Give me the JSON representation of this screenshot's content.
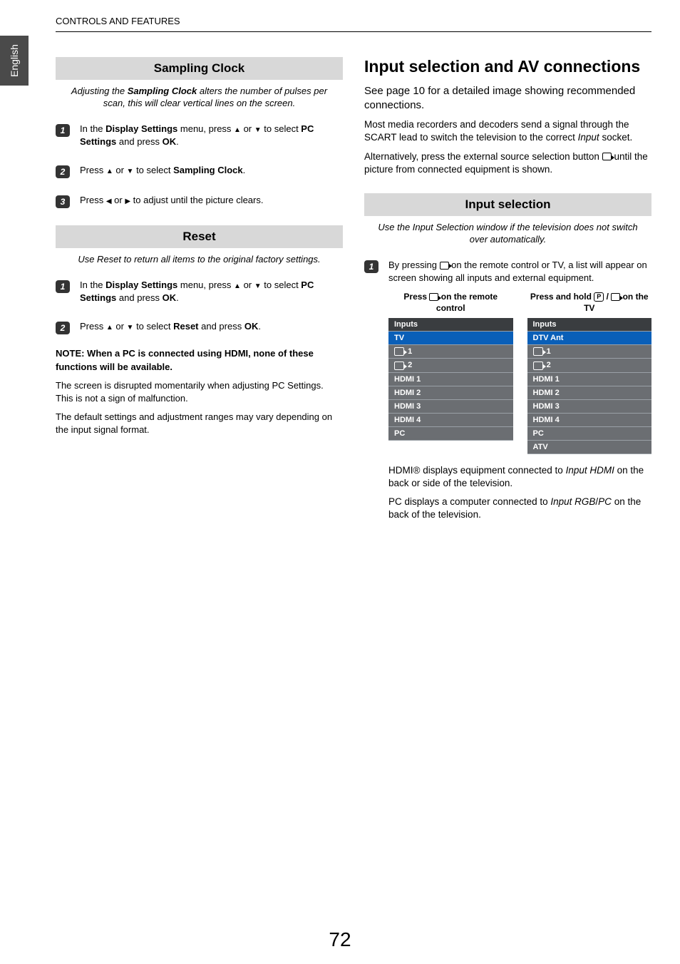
{
  "sideTab": "English",
  "headerText": "CONTROLS AND FEATURES",
  "pageNumber": "72",
  "left": {
    "samplingClock": {
      "title": "Sampling Clock",
      "intro_pre": "Adjusting the ",
      "intro_bold": "Sampling Clock",
      "intro_post": " alters the number of pulses per scan, this will clear vertical lines on the screen.",
      "steps": {
        "s1_a": "In the ",
        "s1_b": "Display Settings",
        "s1_c": " menu, press ",
        "s1_or": " or ",
        "s1_d": " to select ",
        "s1_e": "PC Settings",
        "s1_f": " and press ",
        "s1_g": "OK",
        "s1_h": ".",
        "s2_a": "Press ",
        "s2_b": " to select ",
        "s2_c": "Sampling Clock",
        "s2_d": ".",
        "s3_a": "Press ",
        "s3_b": " or ",
        "s3_c": " to adjust until the picture clears."
      }
    },
    "reset": {
      "title": "Reset",
      "intro": "Use Reset to return all items to the original factory settings.",
      "steps": {
        "s1_a": "In the ",
        "s1_b": "Display Settings",
        "s1_c": " menu, press ",
        "s1_or": " or ",
        "s1_d": " to select ",
        "s1_e": "PC Settings",
        "s1_f": " and press ",
        "s1_g": "OK",
        "s1_h": ".",
        "s2_a": "Press ",
        "s2_b": " to select ",
        "s2_c": "Reset",
        "s2_d": " and press ",
        "s2_e": "OK",
        "s2_f": "."
      }
    },
    "notes": {
      "noteBold": "NOTE: When a PC is connected using HDMI, none of these functions will be available.",
      "p1": "The screen is disrupted momentarily when adjusting PC Settings. This is not a sign of malfunction.",
      "p2": "The default settings and adjustment ranges may vary depending on the input signal format."
    }
  },
  "right": {
    "mainHeading": "Input selection and AV connections",
    "p1": "See page 10 for a detailed image showing recommended connections.",
    "p2_a": "Most media recorders and decoders send a signal through the SCART lead to switch the television to the correct ",
    "p2_i": "Input",
    "p2_b": " socket.",
    "p3_a": "Alternatively, press the external source selection button ",
    "p3_b": " until the picture from connected equipment is shown.",
    "inputSelection": {
      "title": "Input selection",
      "intro": "Use the Input Selection window if the television does not switch over automatically.",
      "step1_a": "By pressing ",
      "step1_b": " on the remote control or TV, a list will appear on screen showing all inputs and external equipment.",
      "col1_head_a": "Press ",
      "col1_head_b": " on the remote control",
      "col2_head_a": "Press and hold ",
      "col2_head_slash": " / ",
      "col2_head_b": " on the TV",
      "table1": {
        "header": "Inputs",
        "selected": "TV",
        "rows": [
          "1",
          "2",
          "HDMI 1",
          "HDMI 2",
          "HDMI 3",
          "HDMI 4",
          "PC"
        ]
      },
      "table2": {
        "header": "Inputs",
        "selected": "DTV Ant",
        "rows": [
          "1",
          "2",
          "HDMI 1",
          "HDMI 2",
          "HDMI 3",
          "HDMI 4",
          "PC",
          "ATV"
        ]
      },
      "foot1_a": "HDMI® displays equipment connected to ",
      "foot1_i": "Input HDMI",
      "foot1_b": " on the back or side of the television.",
      "foot2_a": "PC displays a computer connected to ",
      "foot2_i": "Input RGB",
      "foot2_slash": "/",
      "foot2_i2": "PC",
      "foot2_b": " on the back of the television."
    }
  }
}
